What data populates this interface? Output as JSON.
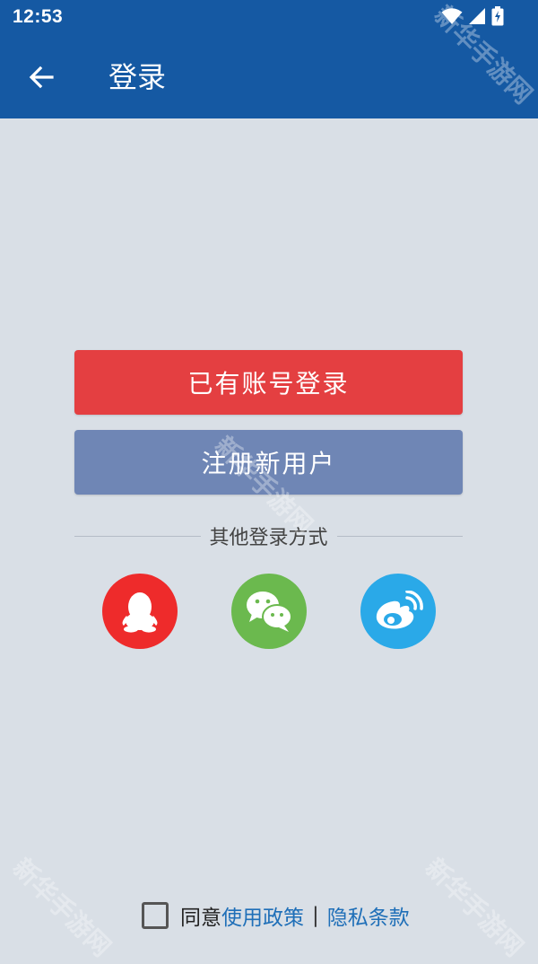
{
  "status_bar": {
    "time": "12:53"
  },
  "app_bar": {
    "title": "登录"
  },
  "buttons": {
    "login": "已有账号登录",
    "register": "注册新用户"
  },
  "other_login": {
    "label": "其他登录方式",
    "providers": [
      "qq-icon",
      "wechat-icon",
      "weibo-icon"
    ]
  },
  "agreement": {
    "prefix": "同意",
    "policy": "使用政策",
    "separator": "|",
    "privacy": "隐私条款",
    "checked": false
  },
  "watermark": "新华手游网",
  "colors": {
    "primary": "#1559a3",
    "login": "#e43f41",
    "register": "#6f86b5",
    "qq": "#ee2b2b",
    "wechat": "#6bb94e",
    "weibo": "#2aa9e8",
    "background": "#d9dfe6",
    "link": "#1f6fb8"
  }
}
